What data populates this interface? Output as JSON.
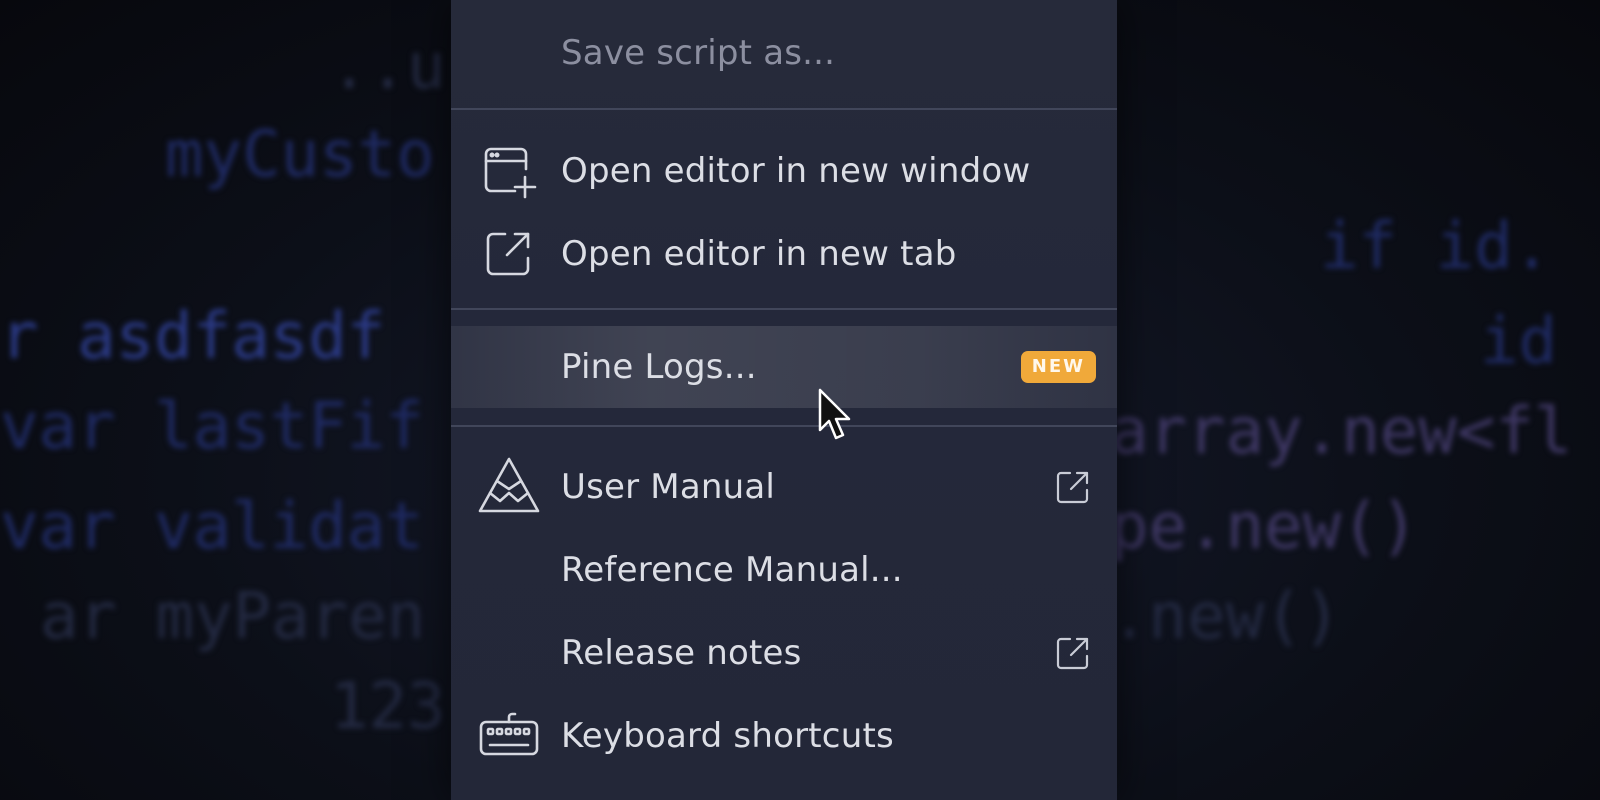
{
  "menu": {
    "items": [
      {
        "label": "Save script as...",
        "icon": "",
        "disabled": true
      },
      {
        "label": "Open editor in new window",
        "icon": "window-plus-icon"
      },
      {
        "label": "Open editor in new tab",
        "icon": "open-in-tab-icon"
      },
      {
        "label": "Pine Logs...",
        "icon": "",
        "badge": "NEW",
        "highlighted": true
      },
      {
        "label": "User Manual",
        "icon": "mountain-logo-icon",
        "external": true
      },
      {
        "label": "Reference Manual...",
        "icon": ""
      },
      {
        "label": "Release notes",
        "icon": "",
        "external": true
      },
      {
        "label": "Keyboard shortcuts",
        "icon": "keyboard-icon"
      }
    ]
  },
  "colors": {
    "menu_bg": "#262a3a",
    "badge": "#f0a93a",
    "text": "#dcdee5",
    "divider": "#41465a"
  }
}
